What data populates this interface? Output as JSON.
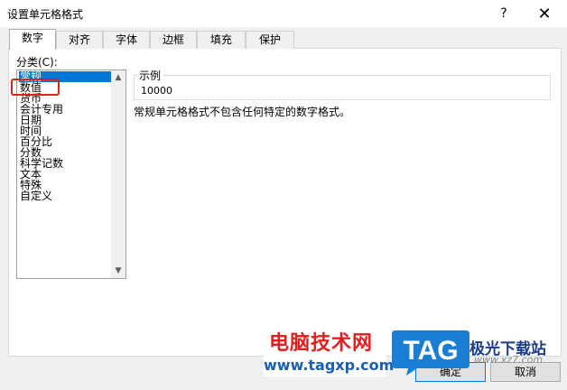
{
  "window": {
    "title": "设置单元格格式",
    "help_glyph": "?",
    "close_glyph": "✕"
  },
  "tabs": [
    {
      "label": "数字",
      "active": true
    },
    {
      "label": "对齐",
      "active": false
    },
    {
      "label": "字体",
      "active": false
    },
    {
      "label": "边框",
      "active": false
    },
    {
      "label": "填充",
      "active": false
    },
    {
      "label": "保护",
      "active": false
    }
  ],
  "category": {
    "label": "分类(C):",
    "items": [
      "常规",
      "数值",
      "货币",
      "会计专用",
      "日期",
      "时间",
      "百分比",
      "分数",
      "科学记数",
      "文本",
      "特殊",
      "自定义"
    ],
    "selected_index": 0,
    "highlighted_index": 1
  },
  "sample": {
    "label": "示例",
    "value": "10000"
  },
  "description": "常规单元格格式不包含任何特定的数字格式。",
  "buttons": {
    "ok": "确定",
    "cancel": "取消"
  },
  "watermark": {
    "site_name": "电脑技术网",
    "site_url": "www.tagxp.com",
    "logo_text": "TAG",
    "right_text": "极光下载站",
    "right_url": "www.xz7.com",
    "colors": {
      "red": "#e02020",
      "blue": "#1a7fd4"
    }
  },
  "colors": {
    "selection": "#0078d7",
    "highlight_box": "#e02020",
    "dialog_bg": "#f0f0f0"
  },
  "icons": {
    "scroll_up": "▲",
    "scroll_down": "▼"
  }
}
